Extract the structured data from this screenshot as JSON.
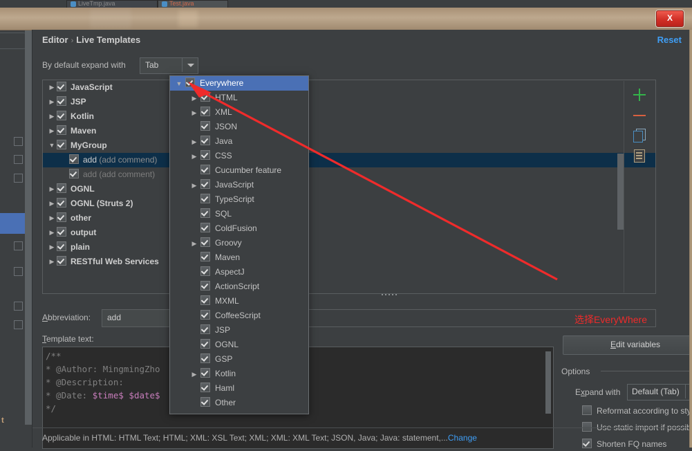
{
  "window": {
    "close_label": "X",
    "tabs": [
      {
        "label": "LiveTmp.java"
      },
      {
        "label": "Test.java"
      }
    ],
    "left_strip_label": "t"
  },
  "dialog": {
    "breadcrumb_root": "Editor",
    "breadcrumb_sep": "›",
    "breadcrumb_leaf": "Live Templates",
    "reset_label": "Reset",
    "expand_with_label": "By default expand with",
    "expand_with_value": "Tab"
  },
  "tree": {
    "rows": [
      {
        "arrow": "▶",
        "checked": true,
        "label": "JavaScript",
        "sub": "",
        "indent": 0,
        "selected": false,
        "dim": false
      },
      {
        "arrow": "▶",
        "checked": true,
        "label": "JSP",
        "sub": "",
        "indent": 0,
        "selected": false,
        "dim": false
      },
      {
        "arrow": "▶",
        "checked": true,
        "label": "Kotlin",
        "sub": "",
        "indent": 0,
        "selected": false,
        "dim": false
      },
      {
        "arrow": "▶",
        "checked": true,
        "label": "Maven",
        "sub": "",
        "indent": 0,
        "selected": false,
        "dim": false
      },
      {
        "arrow": "▼",
        "checked": true,
        "label": "MyGroup",
        "sub": "",
        "indent": 0,
        "selected": false,
        "dim": false
      },
      {
        "arrow": "",
        "checked": true,
        "label": "add",
        "sub": "(add commend)",
        "indent": 1,
        "selected": true,
        "dim": false
      },
      {
        "arrow": "",
        "checked": true,
        "label": "add",
        "sub": "(add comment)",
        "indent": 1,
        "selected": false,
        "dim": true
      },
      {
        "arrow": "▶",
        "checked": true,
        "label": "OGNL",
        "sub": "",
        "indent": 0,
        "selected": false,
        "dim": false
      },
      {
        "arrow": "▶",
        "checked": true,
        "label": "OGNL (Struts 2)",
        "sub": "",
        "indent": 0,
        "selected": false,
        "dim": false
      },
      {
        "arrow": "▶",
        "checked": true,
        "label": "other",
        "sub": "",
        "indent": 0,
        "selected": false,
        "dim": false
      },
      {
        "arrow": "▶",
        "checked": true,
        "label": "output",
        "sub": "",
        "indent": 0,
        "selected": false,
        "dim": false
      },
      {
        "arrow": "▶",
        "checked": true,
        "label": "plain",
        "sub": "",
        "indent": 0,
        "selected": false,
        "dim": false
      },
      {
        "arrow": "▶",
        "checked": true,
        "label": "RESTful Web Services",
        "sub": "",
        "indent": 0,
        "selected": false,
        "dim": false
      }
    ],
    "toolbar": {
      "add_icon": "plus-icon",
      "remove_icon": "minus-icon",
      "copy_icon": "copy-icon",
      "doc_icon": "document-icon"
    }
  },
  "popup": {
    "rows": [
      {
        "arrow": "▼",
        "label": "Everywhere",
        "indent": 0,
        "selected": true
      },
      {
        "arrow": "▶",
        "label": "HTML",
        "indent": 1,
        "selected": false
      },
      {
        "arrow": "▶",
        "label": "XML",
        "indent": 1,
        "selected": false
      },
      {
        "arrow": "",
        "label": "JSON",
        "indent": 1,
        "selected": false
      },
      {
        "arrow": "▶",
        "label": "Java",
        "indent": 1,
        "selected": false
      },
      {
        "arrow": "▶",
        "label": "CSS",
        "indent": 1,
        "selected": false
      },
      {
        "arrow": "",
        "label": "Cucumber feature",
        "indent": 1,
        "selected": false
      },
      {
        "arrow": "▶",
        "label": "JavaScript",
        "indent": 1,
        "selected": false
      },
      {
        "arrow": "",
        "label": "TypeScript",
        "indent": 1,
        "selected": false
      },
      {
        "arrow": "",
        "label": "SQL",
        "indent": 1,
        "selected": false
      },
      {
        "arrow": "",
        "label": "ColdFusion",
        "indent": 1,
        "selected": false
      },
      {
        "arrow": "▶",
        "label": "Groovy",
        "indent": 1,
        "selected": false
      },
      {
        "arrow": "",
        "label": "Maven",
        "indent": 1,
        "selected": false
      },
      {
        "arrow": "",
        "label": "AspectJ",
        "indent": 1,
        "selected": false
      },
      {
        "arrow": "",
        "label": "ActionScript",
        "indent": 1,
        "selected": false
      },
      {
        "arrow": "",
        "label": "MXML",
        "indent": 1,
        "selected": false
      },
      {
        "arrow": "",
        "label": "CoffeeScript",
        "indent": 1,
        "selected": false
      },
      {
        "arrow": "",
        "label": "JSP",
        "indent": 1,
        "selected": false
      },
      {
        "arrow": "",
        "label": "OGNL",
        "indent": 1,
        "selected": false
      },
      {
        "arrow": "",
        "label": "GSP",
        "indent": 1,
        "selected": false
      },
      {
        "arrow": "▶",
        "label": "Kotlin",
        "indent": 1,
        "selected": false
      },
      {
        "arrow": "",
        "label": "Haml",
        "indent": 1,
        "selected": false
      },
      {
        "arrow": "",
        "label": "Other",
        "indent": 1,
        "selected": false
      }
    ]
  },
  "form": {
    "abbreviation_label": "Abbreviation:",
    "abbreviation_value": "add",
    "description_value": "add commend",
    "template_text_label": "Template text:",
    "template_lines": [
      {
        "text": "/**",
        "kind": "comment"
      },
      {
        "text": " * @Author: MingmingZho",
        "kind": "comment"
      },
      {
        "text": " * @Description:",
        "kind": "comment"
      },
      {
        "text": " * @Date: ",
        "kind": "comment",
        "vars": "$time$ $date$"
      },
      {
        "text": " */",
        "kind": "comment"
      }
    ]
  },
  "annotation": {
    "text": "选择EveryWhere",
    "color": "#ee2b2b"
  },
  "options": {
    "edit_variables_label": "Edit variables",
    "title": "Options",
    "expand_with_label": "Expand with",
    "expand_with_value": "Default (Tab)",
    "checkboxes": [
      {
        "label": "Reformat according to style",
        "checked": false
      },
      {
        "label": "Use static import if possible",
        "checked": false
      },
      {
        "label": "Shorten FQ names",
        "checked": true
      }
    ]
  },
  "footer": {
    "text": "Applicable in HTML: HTML Text; HTML; XML: XSL Text; XML; XML: XML Text; JSON, Java; Java: statement,...",
    "change_label": "Change"
  }
}
